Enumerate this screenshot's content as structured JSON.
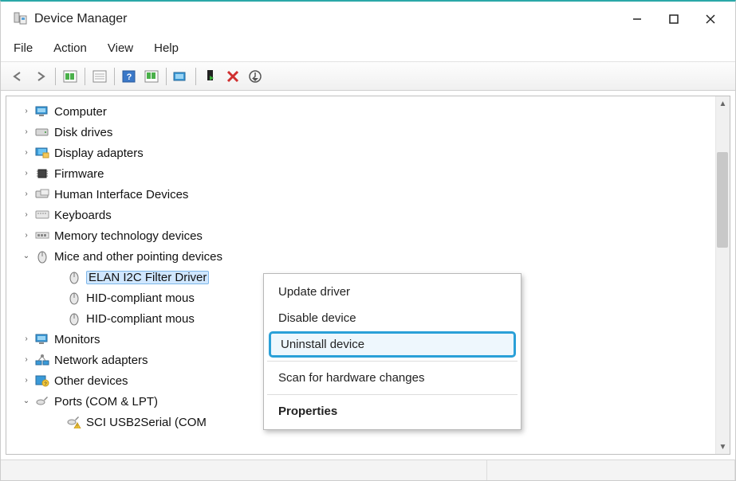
{
  "window": {
    "title": "Device Manager"
  },
  "menubar": {
    "items": [
      "File",
      "Action",
      "View",
      "Help"
    ]
  },
  "tree": {
    "nodes": [
      {
        "label": "Computer",
        "expanded": false,
        "icon": "monitor"
      },
      {
        "label": "Disk drives",
        "expanded": false,
        "icon": "disk"
      },
      {
        "label": "Display adapters",
        "expanded": false,
        "icon": "display"
      },
      {
        "label": "Firmware",
        "expanded": false,
        "icon": "chip"
      },
      {
        "label": "Human Interface Devices",
        "expanded": false,
        "icon": "hid"
      },
      {
        "label": "Keyboards",
        "expanded": false,
        "icon": "keyboard"
      },
      {
        "label": "Memory technology devices",
        "expanded": false,
        "icon": "memory"
      },
      {
        "label": "Mice and other pointing devices",
        "expanded": true,
        "icon": "mouse",
        "children": [
          {
            "label": "ELAN I2C Filter Driver",
            "icon": "mouse",
            "selected": true
          },
          {
            "label": "HID-compliant mous",
            "icon": "mouse"
          },
          {
            "label": "HID-compliant mous",
            "icon": "mouse"
          }
        ]
      },
      {
        "label": "Monitors",
        "expanded": false,
        "icon": "monitor"
      },
      {
        "label": "Network adapters",
        "expanded": false,
        "icon": "network"
      },
      {
        "label": "Other devices",
        "expanded": false,
        "icon": "other-warn"
      },
      {
        "label": "Ports (COM & LPT)",
        "expanded": true,
        "icon": "port",
        "children": [
          {
            "label": "SCI USB2Serial (COM",
            "icon": "port-warn"
          }
        ]
      }
    ]
  },
  "context_menu": {
    "items": [
      {
        "label": "Update driver",
        "highlighted": false
      },
      {
        "label": "Disable device",
        "highlighted": false
      },
      {
        "label": "Uninstall device",
        "highlighted": true
      },
      {
        "sep": true
      },
      {
        "label": "Scan for hardware changes",
        "highlighted": false
      },
      {
        "sep": true
      },
      {
        "label": "Properties",
        "highlighted": false,
        "bold": true
      }
    ]
  }
}
